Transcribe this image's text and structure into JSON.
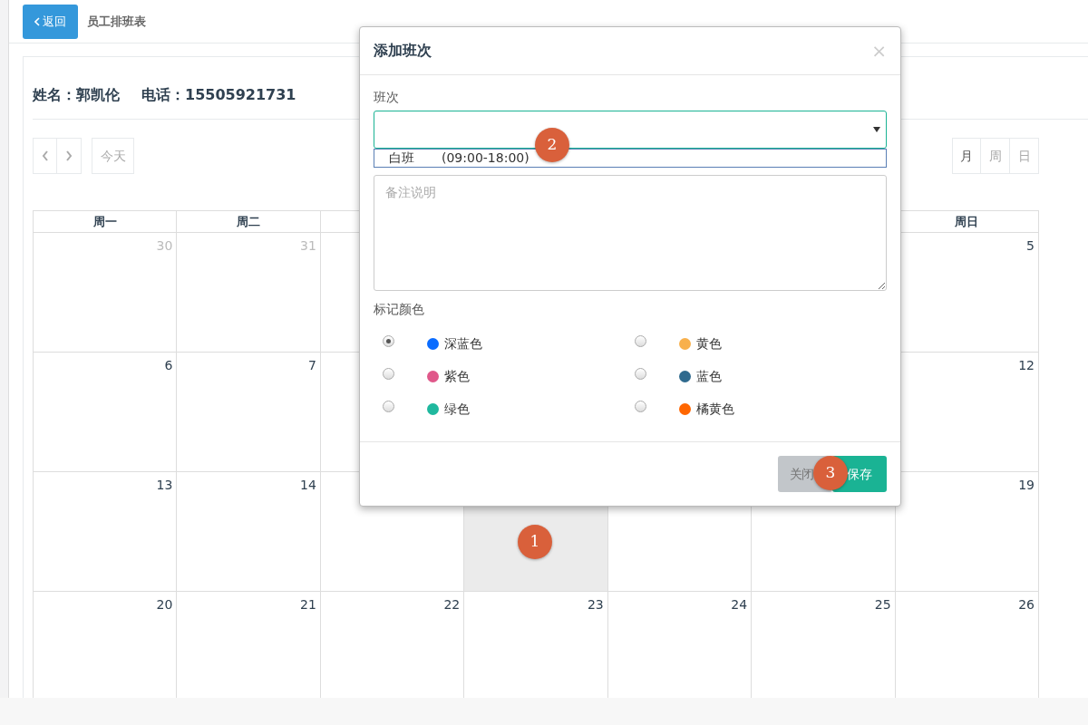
{
  "top_bar": {
    "back_button": "返回",
    "title": "员工排班表"
  },
  "employee": {
    "name": "姓名：郭凯伦",
    "phone": "电话：15505921731"
  },
  "toolbar": {
    "today": "今天",
    "views": [
      {
        "label": "月",
        "selected": true
      },
      {
        "label": "周",
        "selected": false
      },
      {
        "label": "日",
        "selected": false
      }
    ]
  },
  "calendar": {
    "weekdays": {
      "mon": "周一",
      "tue": "周二",
      "sun": "周日"
    },
    "weeks": [
      {
        "mon": {
          "day": "30",
          "muted": true,
          "selected": false
        },
        "tue": {
          "day": "31",
          "muted": true,
          "selected": false
        },
        "sun": {
          "day": "5",
          "muted": false,
          "selected": false
        }
      },
      {
        "mon": {
          "day": "6",
          "muted": false,
          "selected": false
        },
        "tue": {
          "day": "7",
          "muted": false,
          "selected": false
        },
        "sun": {
          "day": "12",
          "muted": false,
          "selected": false
        }
      },
      {
        "mon": {
          "day": "13",
          "muted": false,
          "selected": false
        },
        "tue": {
          "day": "14",
          "muted": false,
          "selected": false
        },
        "wed": {
          "selected": false
        },
        "thu": {
          "selected": true
        },
        "fri": {
          "selected": false
        },
        "sat": {
          "selected": false
        },
        "sun": {
          "day": "19",
          "muted": false,
          "selected": false
        }
      },
      {
        "mon": {
          "day": "20",
          "muted": false,
          "selected": false
        },
        "tue": {
          "day": "21",
          "muted": false,
          "selected": false
        },
        "wed": {
          "day": "22",
          "muted": false,
          "selected": false
        },
        "thu": {
          "day": "23",
          "muted": false,
          "selected": false
        },
        "fri": {
          "day": "24",
          "muted": false,
          "selected": false
        },
        "sat": {
          "day": "25",
          "muted": false,
          "selected": false
        },
        "sun": {
          "day": "26",
          "muted": false,
          "selected": false
        }
      }
    ]
  },
  "dialog": {
    "title": "添加班次",
    "close": "×",
    "shift_label": "班次",
    "dropdown_options": [
      {
        "name": "白班",
        "time": "(09:00-18:00)"
      }
    ],
    "note_placeholder": "备注说明",
    "color_label": "标记颜色",
    "colors": [
      {
        "label": "深蓝色",
        "color": "#0a6cff",
        "selected": true
      },
      {
        "label": "黄色",
        "color": "#f8b04c",
        "selected": false
      },
      {
        "label": "紫色",
        "color": "#e0588a",
        "selected": false
      },
      {
        "label": "蓝色",
        "color": "#2f6a8e",
        "selected": false
      },
      {
        "label": "绿色",
        "color": "#1fb89e",
        "selected": false
      },
      {
        "label": "橘黄色",
        "color": "#ff6600",
        "selected": false
      }
    ],
    "buttons": [
      {
        "label": "关闭",
        "kind": "secondary"
      },
      {
        "label": "保存",
        "kind": "primary"
      }
    ]
  },
  "markers": [
    {
      "label": "1"
    },
    {
      "label": "2"
    },
    {
      "label": "3"
    }
  ]
}
